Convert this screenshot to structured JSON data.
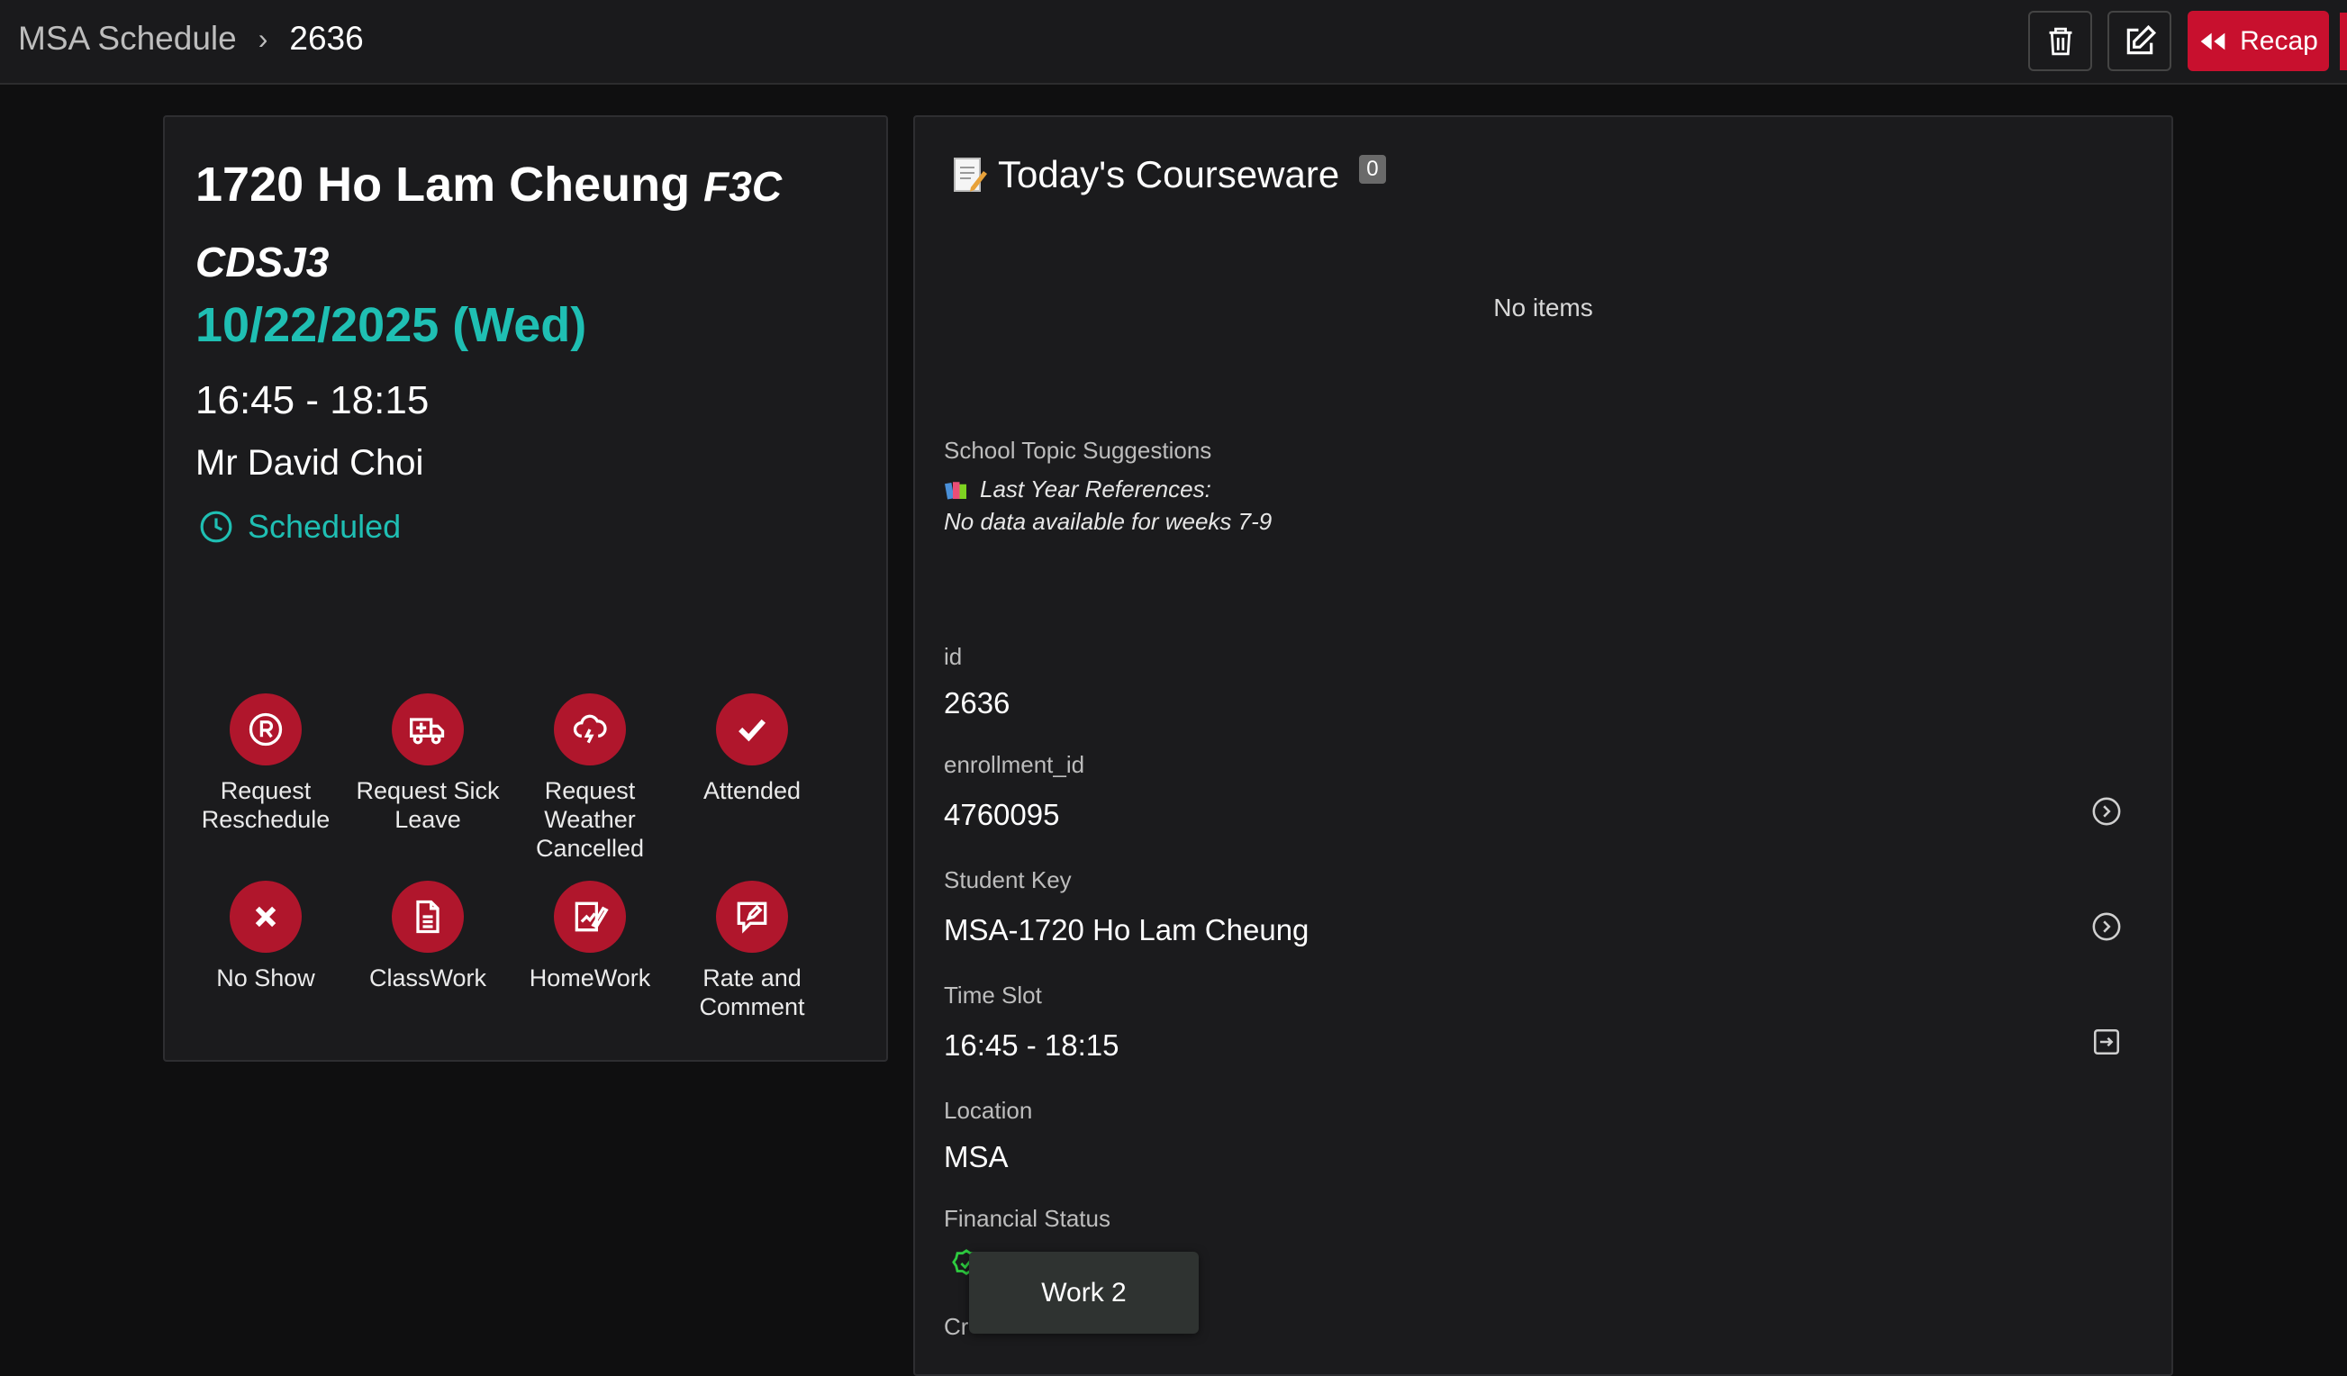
{
  "breadcrumb": {
    "root": "MSA Schedule",
    "current": "2636"
  },
  "toolbar": {
    "trash_icon": "trash-icon",
    "edit_icon": "edit-icon",
    "recap_label": "Recap"
  },
  "lesson": {
    "student_line": "1720 Ho Lam Cheung",
    "grade_tag": "F3C",
    "school_tag": "CDSJ3",
    "date": "10/22/2025 (Wed)",
    "time": "16:45 - 18:15",
    "tutor": "Mr David Choi",
    "status": "Scheduled"
  },
  "actions": [
    {
      "label_1": "Request",
      "label_2": "Reschedule",
      "label_3": "",
      "icon": "reschedule-icon"
    },
    {
      "label_1": "Request Sick",
      "label_2": "Leave",
      "label_3": "",
      "icon": "ambulance-icon"
    },
    {
      "label_1": "Request",
      "label_2": "Weather",
      "label_3": "Cancelled",
      "icon": "storm-cloud-icon"
    },
    {
      "label_1": "Attended",
      "label_2": "",
      "label_3": "",
      "icon": "check-icon"
    },
    {
      "label_1": "No Show",
      "label_2": "",
      "label_3": "",
      "icon": "x-icon"
    },
    {
      "label_1": "ClassWork",
      "label_2": "",
      "label_3": "",
      "icon": "document-icon"
    },
    {
      "label_1": "HomeWork",
      "label_2": "",
      "label_3": "",
      "icon": "pen-paper-icon"
    },
    {
      "label_1": "Rate and",
      "label_2": "Comment",
      "label_3": "",
      "icon": "comment-edit-icon"
    }
  ],
  "courseware": {
    "title": "Today's Courseware",
    "count": "0",
    "empty_text": "No items",
    "school_topic_label": "School Topic Suggestions",
    "last_year_refs": "Last Year References:",
    "no_data_text": "No data available for weeks 7-9"
  },
  "details": {
    "id_label": "id",
    "id_value": "2636",
    "enrollment_label": "enrollment_id",
    "enrollment_value": "4760095",
    "student_key_label": "Student Key",
    "student_key_value": "MSA-1720 Ho Lam Cheung",
    "time_slot_label": "Time Slot",
    "time_slot_value": "16:45 - 18:15",
    "location_label": "Location",
    "location_value": "MSA",
    "financial_label": "Financial Status",
    "cut_label": "Cr"
  },
  "toast": {
    "text": "Work 2"
  },
  "colors": {
    "accent_red": "#c8102e",
    "accent_teal": "#1fbfb3",
    "success_green": "#2ecc40"
  }
}
